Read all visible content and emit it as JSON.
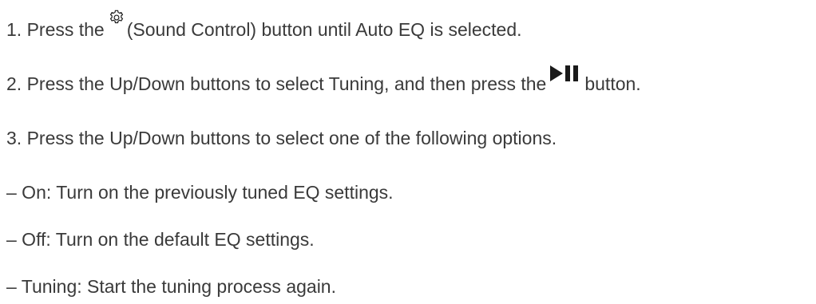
{
  "steps": [
    {
      "prefix": "1. Press the",
      "icon": "gear-icon",
      "suffix": "(Sound Control) button until Auto EQ is selected."
    },
    {
      "prefix": "2. Press the Up/Down buttons to select Tuning, and then press the",
      "icon": "play-pause-icon",
      "suffix": "button."
    },
    {
      "text": "3. Press the Up/Down buttons to select one of the following options."
    }
  ],
  "options": [
    "– On: Turn on the previously tuned EQ settings.",
    "– Off: Turn on the default EQ settings.",
    "– Tuning: Start the tuning process again."
  ],
  "colors": {
    "text": "#3a3a3a",
    "icon": "#1a1a1a"
  }
}
